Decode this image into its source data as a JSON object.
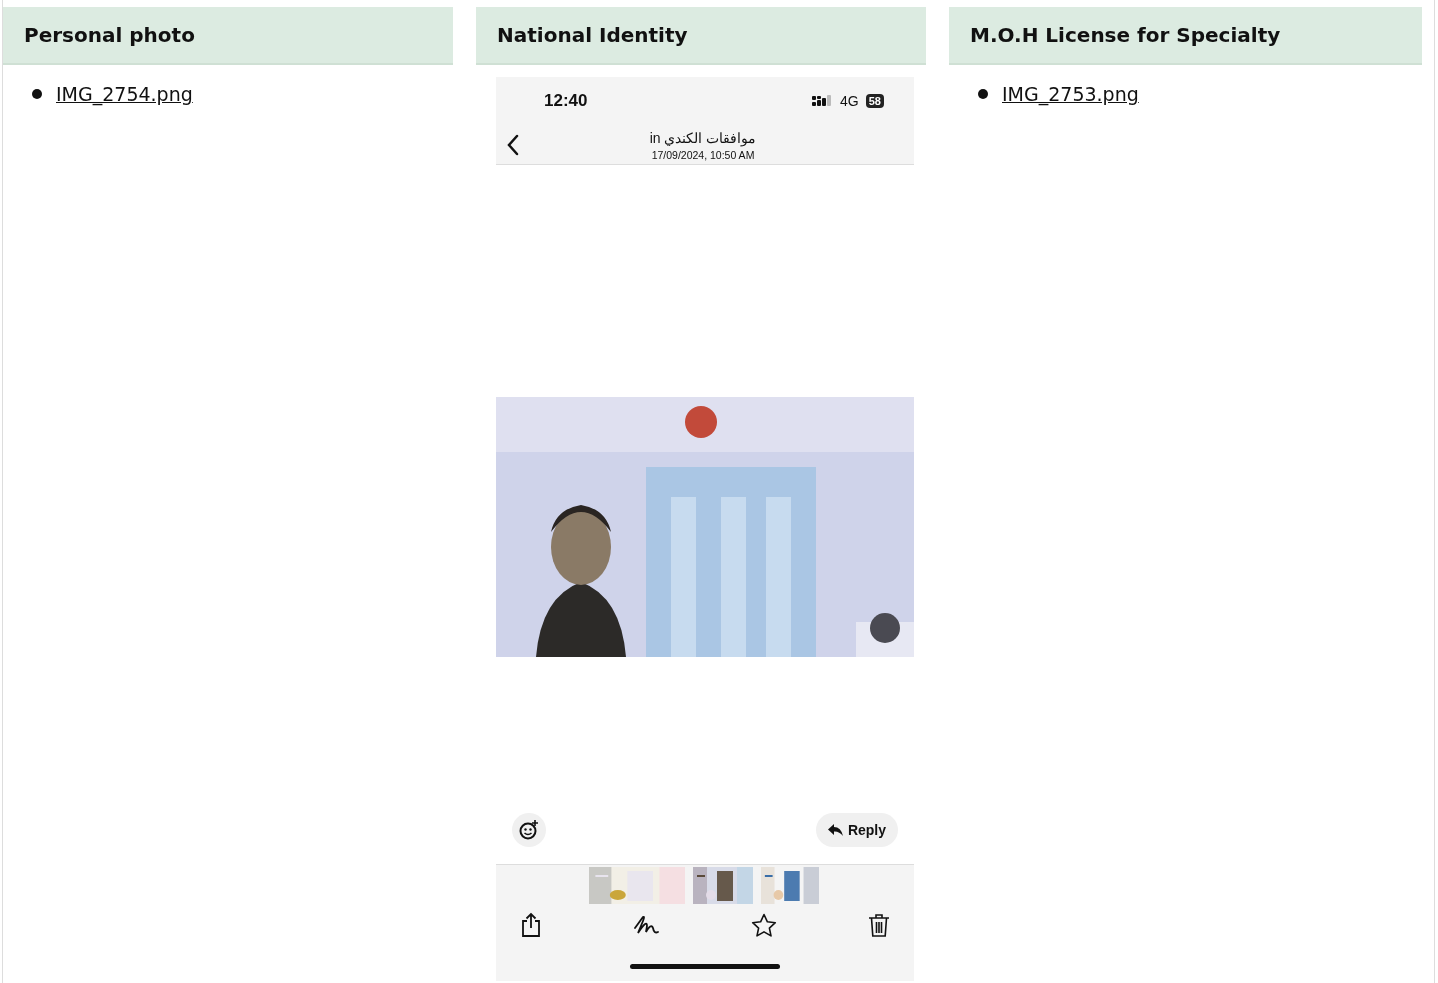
{
  "columns": [
    {
      "title": "Personal photo",
      "kind": "files",
      "files": [
        "IMG_2754.png"
      ]
    },
    {
      "title": "National Identity",
      "kind": "phone",
      "phone": {
        "time": "12:40",
        "network": "4G",
        "battery": "58",
        "chat_title": "موافقات الكندي in",
        "timestamp": "17/09/2024, 10:50 AM",
        "reply_button": "Reply"
      }
    },
    {
      "title": "M.O.H License for Specialty",
      "kind": "files",
      "files": [
        "IMG_2753.png"
      ]
    }
  ]
}
